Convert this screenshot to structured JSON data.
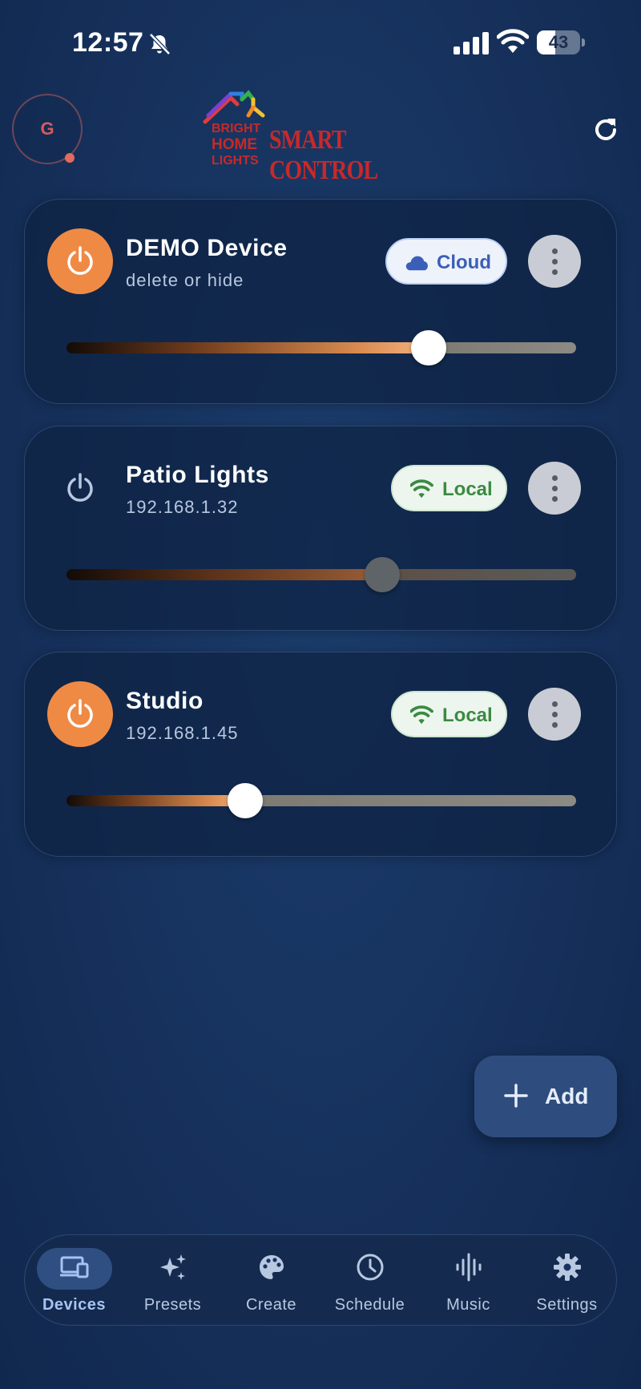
{
  "status_bar": {
    "time": "12:57",
    "battery_level": "43",
    "icons": [
      "bell-slash-icon",
      "cellular-signal-icon",
      "wifi-icon",
      "battery-icon"
    ]
  },
  "header": {
    "avatar_initial": "G",
    "logo": {
      "line1": "BRIGHT",
      "line2": "HOME",
      "line3": "LIGHTS",
      "title": "SMART CONTROL"
    },
    "refresh_icon": "refresh-icon"
  },
  "devices": [
    {
      "name": "DEMO Device",
      "subtitle": "delete or hide",
      "power": "on",
      "connection": "Cloud",
      "connection_icon": "cloud-icon",
      "brightness": 0.71,
      "thumb_color": "#ffffff"
    },
    {
      "name": "Patio Lights",
      "subtitle": "192.168.1.32",
      "power": "off",
      "connection": "Local",
      "connection_icon": "wifi-icon",
      "brightness": 0.62,
      "thumb_color": "#5f6469"
    },
    {
      "name": "Studio",
      "subtitle": "192.168.1.45",
      "power": "on",
      "connection": "Local",
      "connection_icon": "wifi-icon",
      "brightness": 0.35,
      "thumb_color": "#ffffff"
    }
  ],
  "fab": {
    "label": "Add",
    "icon": "plus-icon"
  },
  "nav": {
    "active": "Devices",
    "items": [
      {
        "label": "Devices",
        "icon": "devices-icon"
      },
      {
        "label": "Presets",
        "icon": "sparkles-icon"
      },
      {
        "label": "Create",
        "icon": "palette-icon"
      },
      {
        "label": "Schedule",
        "icon": "clock-icon"
      },
      {
        "label": "Music",
        "icon": "audio-wave-icon"
      },
      {
        "label": "Settings",
        "icon": "gear-icon"
      }
    ]
  },
  "colors": {
    "accent_orange": "#ef8a45",
    "cloud_blue": "#3b5fb6",
    "local_green": "#3b8a43",
    "background": "#17335f"
  }
}
